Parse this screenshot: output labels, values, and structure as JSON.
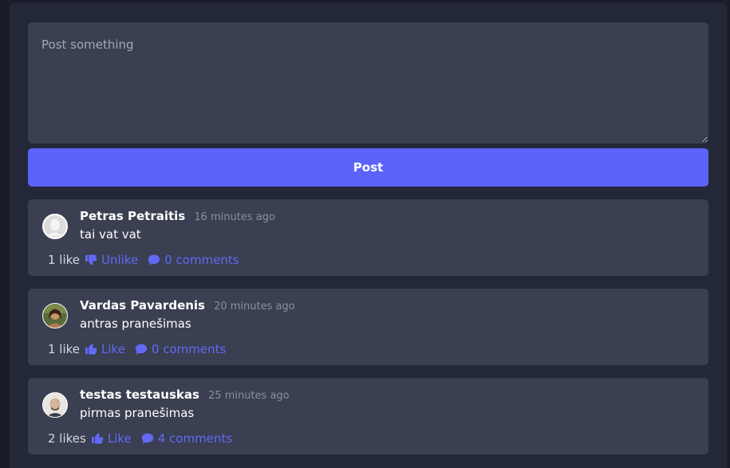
{
  "composer": {
    "placeholder": "Post something",
    "button_label": "Post"
  },
  "posts": [
    {
      "author": "Petras Petraitis",
      "time": "16 minutes ago",
      "text": "tai vat vat",
      "likes": "1 like",
      "like_action": "Unlike",
      "like_icon": "thumbs-down-icon",
      "comments": "0 comments",
      "avatar": "default-avatar"
    },
    {
      "author": "Vardas Pavardenis",
      "time": "20 minutes ago",
      "text": "antras pranešimas",
      "likes": "1 like",
      "like_action": "Like",
      "like_icon": "thumbs-up-icon",
      "comments": "0 comments",
      "avatar": "photo-avatar"
    },
    {
      "author": "testas testauskas",
      "time": "25 minutes ago",
      "text": "pirmas pranešimas",
      "likes": "2 likes",
      "like_action": "Like",
      "like_icon": "thumbs-up-icon",
      "comments": "4 comments",
      "avatar": "photo-avatar"
    }
  ],
  "colors": {
    "background": "#1a1d29",
    "panel": "#232838",
    "card": "#3a3f51",
    "accent": "#5b63fb",
    "link": "#6269f5"
  }
}
